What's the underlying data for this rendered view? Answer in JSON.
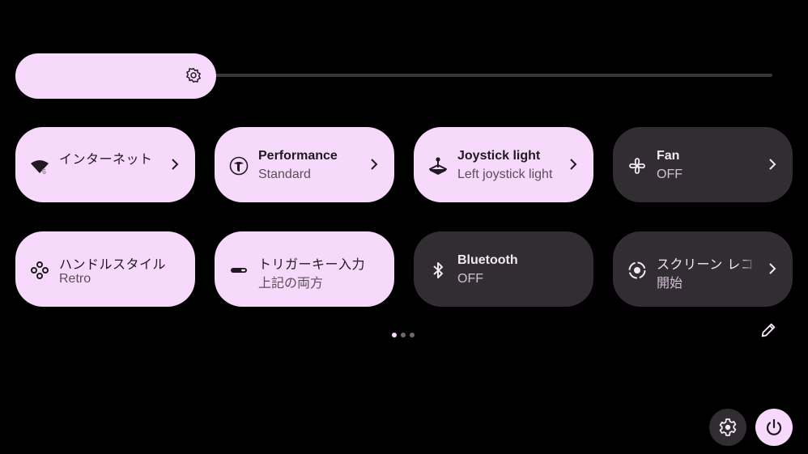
{
  "brightness": {
    "level": 0.24,
    "icon": "brightness-icon"
  },
  "tiles": [
    {
      "label": "インターネット",
      "sub": "",
      "state": "on",
      "icon": "wifi-6-icon",
      "chevron": true
    },
    {
      "label": "Performance",
      "sub": "Standard",
      "state": "on",
      "icon": "performance-icon",
      "chevron": true
    },
    {
      "label": "Joystick light",
      "sub": "Left joystick light",
      "state": "on",
      "icon": "joystick-icon",
      "chevron": true
    },
    {
      "label": "Fan",
      "sub": "OFF",
      "state": "off",
      "icon": "fan-icon",
      "chevron": true
    },
    {
      "label": "ハンドルスタイル",
      "sub": "Retro",
      "state": "on",
      "icon": "gamepad-buttons-icon",
      "chevron": false
    },
    {
      "label": "トリガーキー入力",
      "sub": "上記の両方",
      "state": "on",
      "icon": "trigger-icon",
      "chevron": false
    },
    {
      "label": "Bluetooth",
      "sub": "OFF",
      "state": "off",
      "icon": "bluetooth-icon",
      "chevron": false
    },
    {
      "label": "スクリーン レコーダー",
      "sub": "開始",
      "state": "off",
      "icon": "screen-record-icon",
      "chevron": true
    }
  ],
  "pager": {
    "pages": 3,
    "current": 1
  },
  "colors": {
    "accent": "#f7d9fb",
    "tile_off": "#322d33",
    "background": "#000000"
  }
}
